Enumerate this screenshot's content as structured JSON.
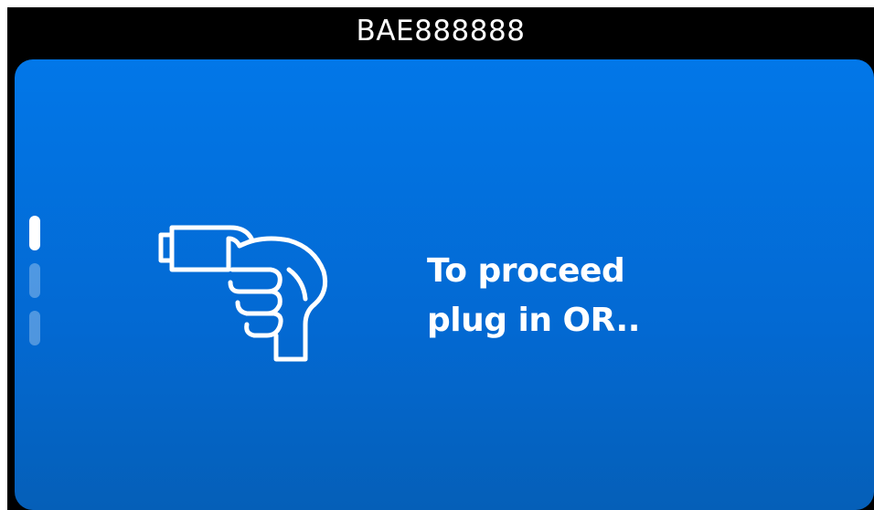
{
  "header": {
    "device_id": "BAE888888"
  },
  "card": {
    "illustration_icon": "hand-holding-charging-plug-icon",
    "message_lines": [
      "To proceed",
      "plug in OR.."
    ]
  },
  "pager": {
    "page_count": 3,
    "active_index": 0
  },
  "colors": {
    "background": "#000000",
    "card_top": "#0277e8",
    "card_bottom": "#055fb8",
    "text": "#ffffff"
  }
}
